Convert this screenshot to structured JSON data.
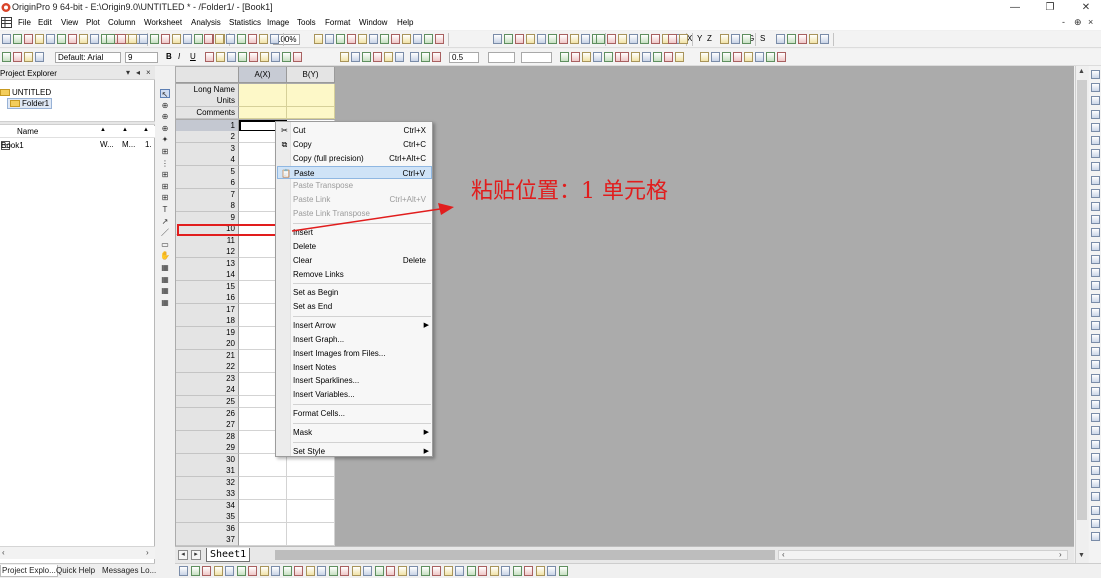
{
  "window": {
    "title": "OriginPro 9 64-bit - E:\\Origin9.0\\UNTITLED * - /Folder1/ - [Book1]",
    "minimize": "—",
    "maximize": "❐",
    "close": "✕"
  },
  "menu": [
    "File",
    "Edit",
    "View",
    "Plot",
    "Column",
    "Worksheet",
    "Analysis",
    "Statistics",
    "Image",
    "Tools",
    "Format",
    "Window",
    "Help"
  ],
  "mdi_controls": {
    "minimize": "-",
    "restore": "⊕",
    "close": "×"
  },
  "toolbar": {
    "zoom": "100%",
    "font_name": "Default: Arial",
    "font_size": "9",
    "bold": "B",
    "italic": "I",
    "underline": "U",
    "line_width": "0.5",
    "axis_letters": [
      "X",
      "Y",
      "Z"
    ],
    "set_letters": [
      "G",
      "S"
    ]
  },
  "project_explorer": {
    "title": "Project Explorer",
    "root": "UNTITLED",
    "folder": "Folder1",
    "list_headers": [
      "Name",
      "▲",
      "▲",
      "▲"
    ],
    "rows": [
      {
        "name": "Book1",
        "type": "W...",
        "view": "M...",
        "size": "1."
      }
    ]
  },
  "bottom_tabs": [
    "Project Explo...",
    "Quick Help",
    "Messages Lo..."
  ],
  "worksheet": {
    "columns": [
      "A(X)",
      "B(Y)"
    ],
    "meta_rows": [
      "Long Name",
      "Units",
      "Comments"
    ],
    "row_count": 37,
    "active_row": 1,
    "sheet_tab": "Sheet1"
  },
  "context_menu": {
    "items": [
      {
        "label": "Cut",
        "shortcut": "Ctrl+X",
        "icon": "cut-icon",
        "glyph": "✂"
      },
      {
        "label": "Copy",
        "shortcut": "Ctrl+C",
        "icon": "copy-icon",
        "glyph": "⧉"
      },
      {
        "label": "Copy (full precision)",
        "shortcut": "Ctrl+Alt+C"
      },
      {
        "label": "Paste",
        "shortcut": "Ctrl+V",
        "icon": "paste-icon",
        "glyph": "📋",
        "highlighted": true
      },
      {
        "label": "Paste Transpose",
        "shortcut": "",
        "disabled": true
      },
      {
        "label": "Paste Link",
        "shortcut": "Ctrl+Alt+V",
        "disabled": true
      },
      {
        "label": "Paste Link Transpose",
        "shortcut": "",
        "disabled": true
      },
      {
        "separator": true
      },
      {
        "label": "Insert",
        "shortcut": ""
      },
      {
        "label": "Delete",
        "shortcut": ""
      },
      {
        "label": "Clear",
        "shortcut": "Delete"
      },
      {
        "label": "Remove Links",
        "shortcut": ""
      },
      {
        "separator": true
      },
      {
        "label": "Set as Begin",
        "shortcut": ""
      },
      {
        "label": "Set as End",
        "shortcut": ""
      },
      {
        "separator": true
      },
      {
        "label": "Insert Arrow",
        "submenu": true
      },
      {
        "label": "Insert Graph...",
        "shortcut": ""
      },
      {
        "label": "Insert Images from Files...",
        "shortcut": ""
      },
      {
        "label": "Insert Notes",
        "shortcut": ""
      },
      {
        "label": "Insert Sparklines...",
        "shortcut": ""
      },
      {
        "label": "Insert Variables...",
        "shortcut": ""
      },
      {
        "separator": true
      },
      {
        "label": "Format Cells...",
        "shortcut": ""
      },
      {
        "separator": true
      },
      {
        "label": "Mask",
        "submenu": true
      },
      {
        "separator": true
      },
      {
        "label": "Set Style",
        "submenu": true
      }
    ]
  },
  "annotation": {
    "text": "粘贴位置：1 单元格",
    "color": "#e11d1d"
  },
  "colors": {
    "metadata_cell": "#fdf8c8",
    "menu_highlight": "#cfe3f7",
    "mdi_background": "#ababab"
  }
}
